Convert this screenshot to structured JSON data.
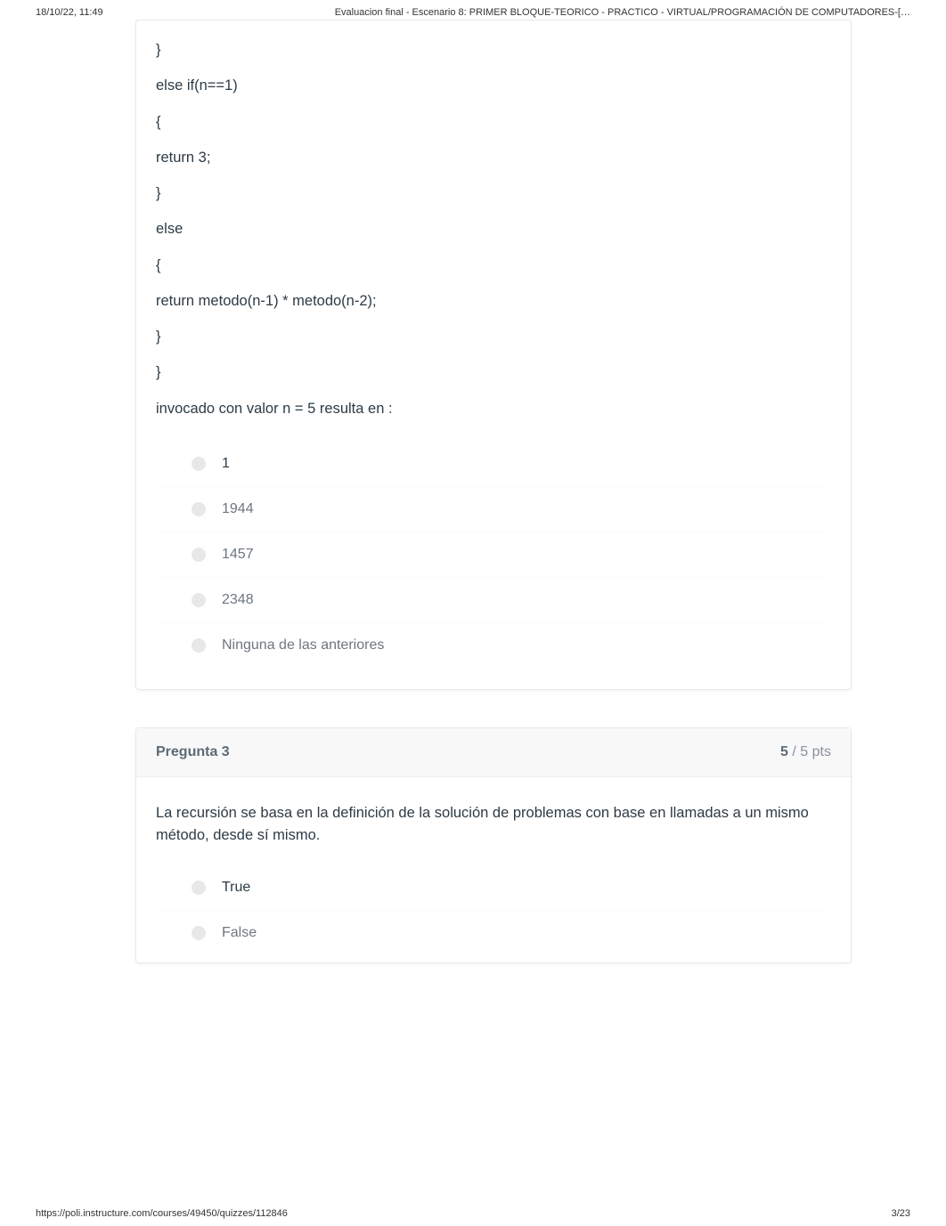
{
  "header": {
    "datetime": "18/10/22, 11:49",
    "title": "Evaluacion final - Escenario 8: PRIMER BLOQUE-TEORICO - PRACTICO - VIRTUAL/PROGRAMACIÓN DE COMPUTADORES-[…"
  },
  "question2": {
    "code_lines": [
      "}",
      "else if(n==1)",
      "{",
      " return 3;",
      "}",
      "else",
      "{",
      " return metodo(n-1) * metodo(n-2);",
      "}",
      "}",
      "invocado con valor n = 5 resulta en :"
    ],
    "answers": [
      {
        "text": "1",
        "selected": true
      },
      {
        "text": "1944",
        "selected": false
      },
      {
        "text": "1457",
        "selected": false
      },
      {
        "text": "2348",
        "selected": false
      },
      {
        "text": "Ninguna de las anteriores",
        "selected": false
      }
    ]
  },
  "question3": {
    "title": "Pregunta 3",
    "points_earned": "5",
    "points_sep": " / ",
    "points_total": "5",
    "points_suffix": " pts",
    "prompt": "La recursión se basa en la definición de la solución de problemas con base en llamadas a un mismo método, desde sí mismo.",
    "answers": [
      {
        "text": "True",
        "selected": true
      },
      {
        "text": "False",
        "selected": false
      }
    ]
  },
  "footer": {
    "url": "https://poli.instructure.com/courses/49450/quizzes/112846",
    "page": "3/23"
  }
}
